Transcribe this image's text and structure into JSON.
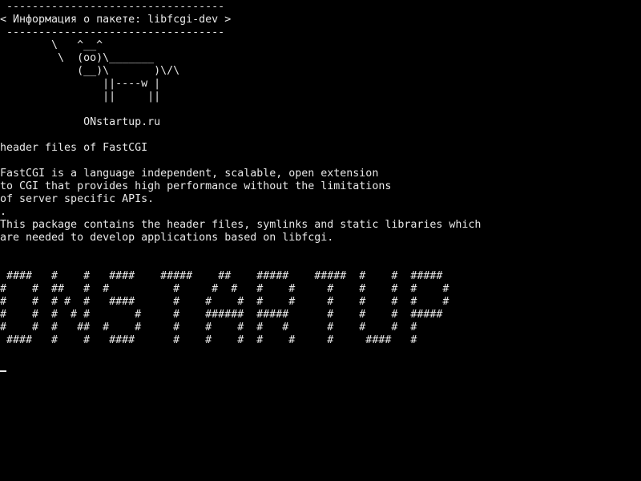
{
  "theme": {
    "background": "#000000",
    "foreground": "#e8e8e8"
  },
  "banner": {
    "border_top": " ----------------------------------",
    "title": "< Информация о пакете: libfcgi-dev >",
    "border_bottom": " ----------------------------------"
  },
  "cow": {
    "lines": [
      "        \\   ^__^",
      "         \\  (oo)\\_______",
      "            (__)\\       )\\/\\",
      "                ||----w |",
      "                ||     ||"
    ]
  },
  "site": "             ONstartup.ru",
  "summary": "header files of FastCGI",
  "description": {
    "lines": [
      "FastCGI is a language independent, scalable, open extension",
      "to CGI that provides high performance without the limitations",
      "of server specific APIs.",
      ".",
      "This package contains the header files, symlinks and static libraries which",
      "are needed to develop applications based on libfcgi."
    ]
  },
  "big_text": {
    "lines": [
      " ####   #    #   ####    #####    ##    #####    #####  #    #  #####",
      "#    #  ##   #  #          #     #  #   #    #     #    #    #  #    #",
      "#    #  # #  #   ####      #    #    #  #    #     #    #    #  #    #",
      "#    #  #  # #       #     #    ######  #####      #    #    #  #####",
      "#    #  #   ##  #    #     #    #    #  #   #      #    #    #  #",
      " ####   #    #   ####      #    #    #  #    #     #     ####   #"
    ]
  }
}
